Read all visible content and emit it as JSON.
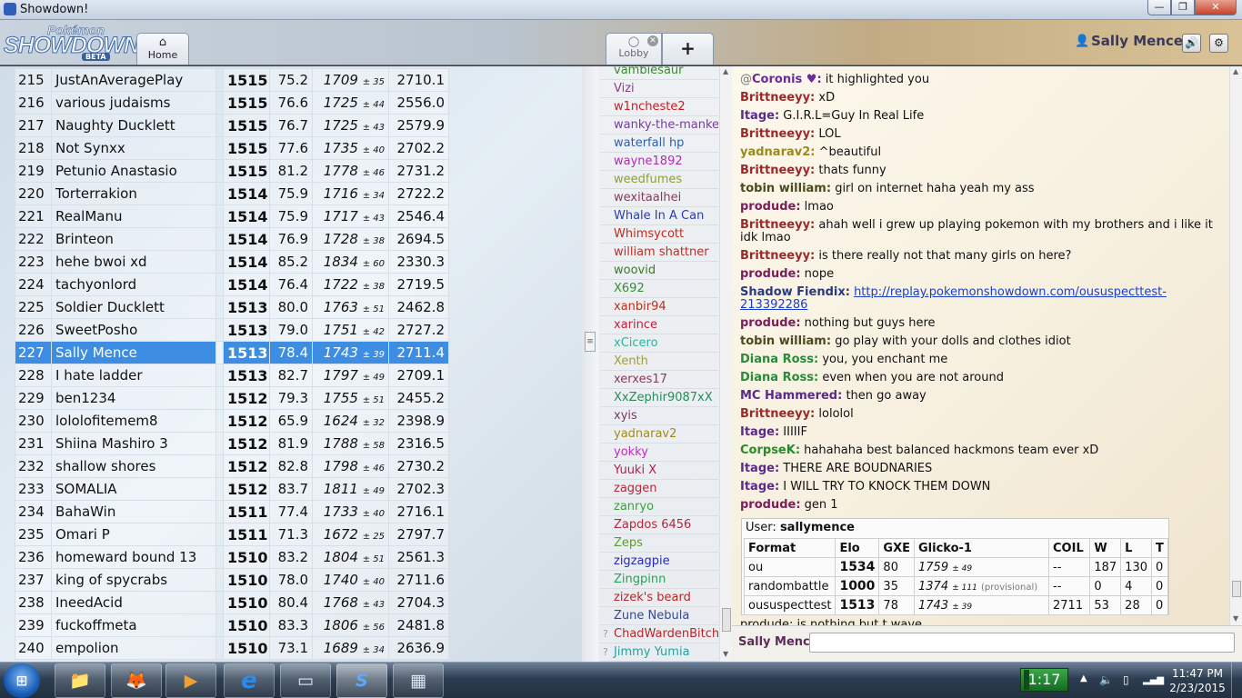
{
  "window": {
    "title": "Showdown!"
  },
  "header": {
    "logo_top": "Pokémon",
    "logo_main": "SHOWDOWN",
    "logo_badge": "BETA",
    "home_label": "Home",
    "lobby_label": "Lobby",
    "new_tab_label": "+",
    "username": "Sally Mence"
  },
  "ladder": {
    "rows": [
      {
        "rank": "215",
        "name": "JustAnAveragePlay",
        "elo": "1515",
        "gxe": "75.2",
        "glicko": "1709",
        "dev": "± 35",
        "coil": "2710.1"
      },
      {
        "rank": "216",
        "name": "various judaisms",
        "elo": "1515",
        "gxe": "76.6",
        "glicko": "1725",
        "dev": "± 44",
        "coil": "2556.0"
      },
      {
        "rank": "217",
        "name": "Naughty Ducklett",
        "elo": "1515",
        "gxe": "76.7",
        "glicko": "1725",
        "dev": "± 43",
        "coil": "2579.9"
      },
      {
        "rank": "218",
        "name": "Not Synxx",
        "elo": "1515",
        "gxe": "77.6",
        "glicko": "1735",
        "dev": "± 40",
        "coil": "2702.2"
      },
      {
        "rank": "219",
        "name": "Petunio Anastasio",
        "elo": "1515",
        "gxe": "81.2",
        "glicko": "1778",
        "dev": "± 46",
        "coil": "2731.2"
      },
      {
        "rank": "220",
        "name": "Torterrakion",
        "elo": "1514",
        "gxe": "75.9",
        "glicko": "1716",
        "dev": "± 34",
        "coil": "2722.2"
      },
      {
        "rank": "221",
        "name": "RealManu",
        "elo": "1514",
        "gxe": "75.9",
        "glicko": "1717",
        "dev": "± 43",
        "coil": "2546.4"
      },
      {
        "rank": "222",
        "name": "Brinteon",
        "elo": "1514",
        "gxe": "76.9",
        "glicko": "1728",
        "dev": "± 38",
        "coil": "2694.5"
      },
      {
        "rank": "223",
        "name": "hehe bwoi xd",
        "elo": "1514",
        "gxe": "85.2",
        "glicko": "1834",
        "dev": "± 60",
        "coil": "2330.3"
      },
      {
        "rank": "224",
        "name": "tachyonlord",
        "elo": "1514",
        "gxe": "76.4",
        "glicko": "1722",
        "dev": "± 38",
        "coil": "2719.5"
      },
      {
        "rank": "225",
        "name": "Soldier Ducklett",
        "elo": "1513",
        "gxe": "80.0",
        "glicko": "1763",
        "dev": "± 51",
        "coil": "2462.8"
      },
      {
        "rank": "226",
        "name": "SweetPosho",
        "elo": "1513",
        "gxe": "79.0",
        "glicko": "1751",
        "dev": "± 42",
        "coil": "2727.2"
      },
      {
        "rank": "227",
        "name": "Sally Mence",
        "elo": "1513",
        "gxe": "78.4",
        "glicko": "1743",
        "dev": "± 39",
        "coil": "2711.4"
      },
      {
        "rank": "228",
        "name": "I hate ladder",
        "elo": "1513",
        "gxe": "82.7",
        "glicko": "1797",
        "dev": "± 49",
        "coil": "2709.1"
      },
      {
        "rank": "229",
        "name": "ben1234",
        "elo": "1512",
        "gxe": "79.3",
        "glicko": "1755",
        "dev": "± 51",
        "coil": "2455.2"
      },
      {
        "rank": "230",
        "name": "lololofitemem8",
        "elo": "1512",
        "gxe": "65.9",
        "glicko": "1624",
        "dev": "± 32",
        "coil": "2398.9"
      },
      {
        "rank": "231",
        "name": "Shiina Mashiro 3",
        "elo": "1512",
        "gxe": "81.9",
        "glicko": "1788",
        "dev": "± 58",
        "coil": "2316.5"
      },
      {
        "rank": "232",
        "name": "shallow shores",
        "elo": "1512",
        "gxe": "82.8",
        "glicko": "1798",
        "dev": "± 46",
        "coil": "2730.2"
      },
      {
        "rank": "233",
        "name": "SOMALIA",
        "elo": "1512",
        "gxe": "83.7",
        "glicko": "1811",
        "dev": "± 49",
        "coil": "2702.3"
      },
      {
        "rank": "234",
        "name": "BahaWin",
        "elo": "1511",
        "gxe": "77.4",
        "glicko": "1733",
        "dev": "± 40",
        "coil": "2716.1"
      },
      {
        "rank": "235",
        "name": "Omari P",
        "elo": "1511",
        "gxe": "71.3",
        "glicko": "1672",
        "dev": "± 25",
        "coil": "2797.7"
      },
      {
        "rank": "236",
        "name": "homeward bound 13",
        "elo": "1510",
        "gxe": "83.2",
        "glicko": "1804",
        "dev": "± 51",
        "coil": "2561.3"
      },
      {
        "rank": "237",
        "name": "king of spycrabs",
        "elo": "1510",
        "gxe": "78.0",
        "glicko": "1740",
        "dev": "± 40",
        "coil": "2711.6"
      },
      {
        "rank": "238",
        "name": "IneedAcid",
        "elo": "1510",
        "gxe": "80.4",
        "glicko": "1768",
        "dev": "± 43",
        "coil": "2704.3"
      },
      {
        "rank": "239",
        "name": "fuckoffmeta",
        "elo": "1510",
        "gxe": "83.3",
        "glicko": "1806",
        "dev": "± 56",
        "coil": "2481.8"
      },
      {
        "rank": "240",
        "name": "empolion",
        "elo": "1510",
        "gxe": "73.1",
        "glicko": "1689",
        "dev": "± 34",
        "coil": "2636.9"
      }
    ]
  },
  "userlist": {
    "users": [
      {
        "name": "vambiesaur",
        "color": "#3a8a2e"
      },
      {
        "name": "Vizi",
        "color": "#9a3a8a"
      },
      {
        "name": "w1ncheste2",
        "color": "#c81e1e"
      },
      {
        "name": "wanky-the-manke",
        "color": "#7a3aa0"
      },
      {
        "name": "waterfall hp",
        "color": "#2f5fa8"
      },
      {
        "name": "wayne1892",
        "color": "#b42ab4"
      },
      {
        "name": "weedfumes",
        "color": "#8aa03a"
      },
      {
        "name": "wexitaalhei",
        "color": "#8a3a5a"
      },
      {
        "name": "Whale In A Can",
        "color": "#2a3ab0"
      },
      {
        "name": "Whimsycott",
        "color": "#c8281e"
      },
      {
        "name": "william shattner",
        "color": "#b43228"
      },
      {
        "name": "woovid",
        "color": "#3a7a2a"
      },
      {
        "name": "X692",
        "color": "#3a8a3a"
      },
      {
        "name": "xanbir94",
        "color": "#b4321e"
      },
      {
        "name": "xarince",
        "color": "#c41e3c"
      },
      {
        "name": "xCicero",
        "color": "#2ab4a0"
      },
      {
        "name": "Xenth",
        "color": "#a0a03a"
      },
      {
        "name": "xerxes17",
        "color": "#8a3a5a"
      },
      {
        "name": "XxZephir9087xX",
        "color": "#2a8a5a"
      },
      {
        "name": "xyis",
        "color": "#7a3a6a"
      },
      {
        "name": "yadnarav2",
        "color": "#a08a1e"
      },
      {
        "name": "yokky",
        "color": "#c428c4"
      },
      {
        "name": "Yuuki X",
        "color": "#b41e4a"
      },
      {
        "name": "zaggen",
        "color": "#b4283c"
      },
      {
        "name": "zanryo",
        "color": "#3aa03a"
      },
      {
        "name": "Zapdos 6456",
        "color": "#b4283c"
      },
      {
        "name": "Zeps",
        "color": "#5aa02a"
      },
      {
        "name": "zigzagpie",
        "color": "#2a2ab4"
      },
      {
        "name": "Zingpinn",
        "color": "#2aa05a"
      },
      {
        "name": "zizek's beard",
        "color": "#b42828"
      },
      {
        "name": "Zune Nebula",
        "color": "#3a4a8a"
      },
      {
        "name": "ChadWardenBitch",
        "color": "#b4282a",
        "glyph": "?"
      },
      {
        "name": "Jimmy Yumia",
        "color": "#2aa0a0",
        "glyph": "?"
      }
    ]
  },
  "chat": {
    "lines": [
      {
        "rank": "@",
        "name": "Coronis ♥:",
        "color": "#6a2a9a",
        "text": "it highlighted you"
      },
      {
        "name": "Brittneeyy:",
        "color": "#9a2a2a",
        "text": "xD"
      },
      {
        "name": "Itage:",
        "color": "#5a2a8a",
        "text": "G.I.R.L=Guy In Real Life"
      },
      {
        "name": "Brittneeyy:",
        "color": "#9a2a2a",
        "text": "LOL"
      },
      {
        "name": "yadnarav2:",
        "color": "#9a8a1e",
        "text": "^beautiful"
      },
      {
        "name": "Brittneeyy:",
        "color": "#9a2a2a",
        "text": "thats funny"
      },
      {
        "name": "tobin william:",
        "color": "#4a4a1e",
        "text": "girl on internet haha yeah my ass"
      },
      {
        "name": "produde:",
        "color": "#7a1e5a",
        "text": "lmao"
      },
      {
        "name": "Brittneeyy:",
        "color": "#9a2a2a",
        "text": "ahah well i grew up playing pokemon with my brothers and i like it idk lmao"
      },
      {
        "name": "Brittneeyy:",
        "color": "#9a2a2a",
        "text": "is there really not that many girls on here?"
      },
      {
        "name": "produde:",
        "color": "#7a1e5a",
        "text": "nope"
      },
      {
        "name": "Shadow Fiendix:",
        "color": "#2a3a7a",
        "link": "http://replay.pokemonshowdown.com/oususpecttest-213392286"
      },
      {
        "name": "produde:",
        "color": "#7a1e5a",
        "text": "nothing but guys here"
      },
      {
        "name": "tobin william:",
        "color": "#4a4a1e",
        "text": "go play with your dolls and clothes idiot"
      },
      {
        "name": "Diana Ross:",
        "color": "#2a8a3a",
        "text": "you, you enchant me"
      },
      {
        "name": "Diana Ross:",
        "color": "#2a8a3a",
        "text": "even when you are not around"
      },
      {
        "name": "MC Hammered:",
        "color": "#5a2a8a",
        "text": "then go away"
      },
      {
        "name": "Brittneeyy:",
        "color": "#9a2a2a",
        "text": "lololol"
      },
      {
        "name": "Itage:",
        "color": "#5a2a8a",
        "text": "IIIIIF"
      },
      {
        "name": "CorpseK:",
        "color": "#2a8a2a",
        "text": "hahahaha best balanced hackmons team ever xD"
      },
      {
        "name": "Itage:",
        "color": "#5a2a8a",
        "text": "THERE ARE BOUDNARIES"
      },
      {
        "name": "Itage:",
        "color": "#5a2a8a",
        "text": "I WILL TRY TO KNOCK THEM DOWN"
      },
      {
        "name": "produde:",
        "color": "#7a1e5a",
        "text": "gen 1"
      }
    ],
    "clipped_line": "produde:  is nothing but t wave",
    "userinfo": {
      "title_prefix": "User:",
      "user": "sallymence",
      "headers": [
        "Format",
        "Elo",
        "GXE",
        "Glicko-1",
        "COIL",
        "W",
        "L",
        "T"
      ],
      "rows": [
        {
          "format": "ou",
          "elo": "1534",
          "gxe": "80",
          "glicko": "1759",
          "dev": "± 49",
          "prov": "",
          "coil": "--",
          "w": "187",
          "l": "130",
          "t": "0"
        },
        {
          "format": "randombattle",
          "elo": "1000",
          "gxe": "35",
          "glicko": "1374",
          "dev": "± 111",
          "prov": "(provisional)",
          "coil": "--",
          "w": "0",
          "l": "4",
          "t": "0"
        },
        {
          "format": "oususpecttest",
          "elo": "1513",
          "gxe": "78",
          "glicko": "1743",
          "dev": "± 39",
          "prov": "",
          "coil": "2711",
          "w": "53",
          "l": "28",
          "t": "0"
        }
      ]
    },
    "input_name": "Sally Mence"
  },
  "taskbar": {
    "start_glyph": "⊞",
    "apps": [
      {
        "icon": "folder-icon",
        "glyph": "📁"
      },
      {
        "icon": "firefox-icon",
        "glyph": "🦊"
      },
      {
        "icon": "media-player-icon",
        "glyph": "▶"
      },
      {
        "icon": "ie-icon",
        "glyph": "e"
      },
      {
        "icon": "notepad-icon",
        "glyph": "▭"
      },
      {
        "icon": "showdown-icon",
        "glyph": "S"
      },
      {
        "icon": "calculator-icon",
        "glyph": "▦"
      }
    ],
    "timer": "1:17",
    "time": "11:47 PM",
    "date": "2/23/2015"
  }
}
